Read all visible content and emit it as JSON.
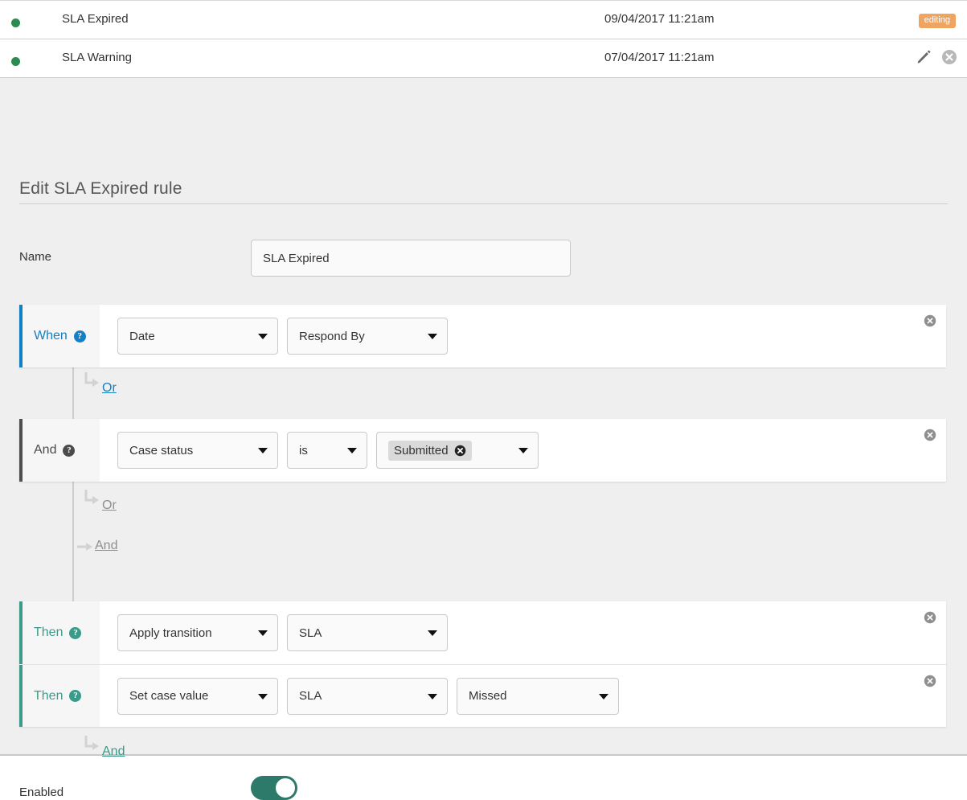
{
  "list": {
    "rows": [
      {
        "name": "SLA Expired",
        "date": "09/04/2017 11:21am",
        "badge": "editing",
        "status_color": "#2e8b50"
      },
      {
        "name": "SLA Warning",
        "date": "07/04/2017 11:21am",
        "badge": null,
        "status_color": "#2e8b50"
      }
    ]
  },
  "editor": {
    "title": "Edit SLA Expired rule",
    "name_label": "Name",
    "name_value": "SLA Expired",
    "name_placeholder": "Name",
    "enabled_label": "Enabled",
    "enabled_value": true
  },
  "rules": {
    "when": {
      "label": "When",
      "accent": "#1580c4",
      "selects": [
        {
          "value": "Date",
          "width": "w-200"
        },
        {
          "value": "Respond By",
          "width": "w-200"
        }
      ]
    },
    "and": {
      "label": "And",
      "accent": "#4b4b4b",
      "selects": [
        {
          "value": "Case status",
          "width": "w-200"
        },
        {
          "value": "is",
          "width": "w-100"
        }
      ],
      "chip_select": {
        "chip_label": "Submitted",
        "width": "w-202"
      }
    },
    "then1": {
      "label": "Then",
      "accent": "#3c9a8a",
      "selects": [
        {
          "value": "Apply transition",
          "width": "w-200"
        },
        {
          "value": "SLA",
          "width": "w-200"
        }
      ]
    },
    "then2": {
      "label": "Then",
      "accent": "#3c9a8a",
      "selects": [
        {
          "value": "Set case value",
          "width": "w-200"
        },
        {
          "value": "SLA",
          "width": "w-200"
        },
        {
          "value": "Missed",
          "width": "w-202"
        }
      ]
    }
  },
  "connectors": {
    "or_1": "Or",
    "or_2": "Or",
    "and_2": "And",
    "and_3": "And"
  }
}
